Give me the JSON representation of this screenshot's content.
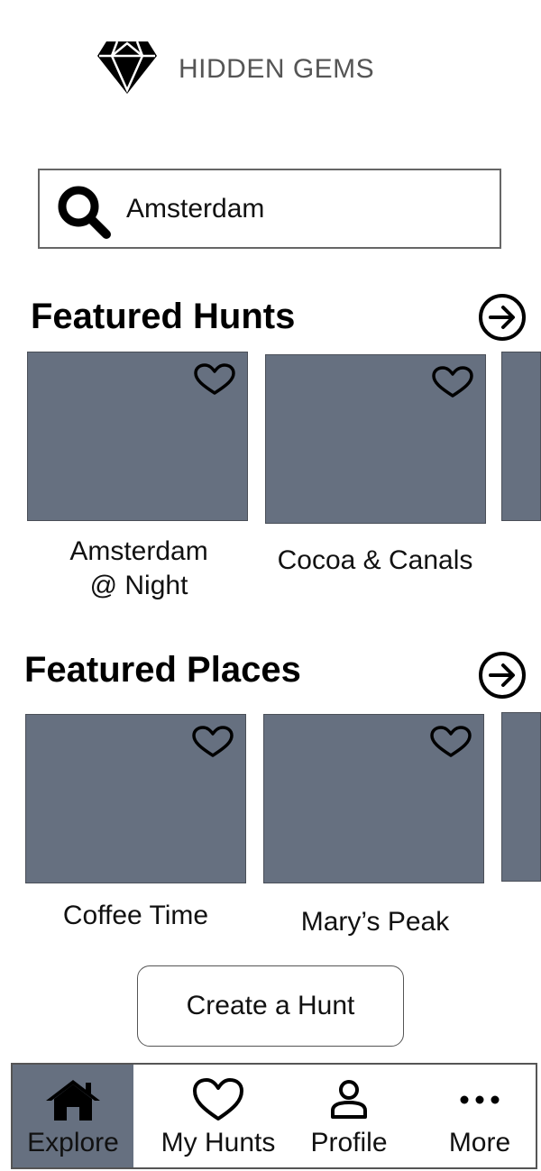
{
  "header": {
    "title": "HIDDEN GEMS",
    "logo_icon": "diamond-icon"
  },
  "search": {
    "value": "Amsterdam",
    "icon": "search-icon"
  },
  "featured_hunts": {
    "title": "Featured Hunts",
    "items": [
      {
        "label_line1": "Amsterdam",
        "label_line2": "@ Night"
      },
      {
        "label_line1": "Cocoa & Canals",
        "label_line2": ""
      }
    ]
  },
  "featured_places": {
    "title": "Featured Places",
    "items": [
      {
        "label_line1": "Coffee Time"
      },
      {
        "label_line1": "Mary’s Peak"
      }
    ]
  },
  "create_button": {
    "label": "Create a Hunt"
  },
  "nav": {
    "items": [
      {
        "label": "Explore",
        "icon": "home-icon",
        "active": true
      },
      {
        "label": "My Hunts",
        "icon": "heart-icon",
        "active": false
      },
      {
        "label": "Profile",
        "icon": "person-icon",
        "active": false
      },
      {
        "label": "More",
        "icon": "more-icon",
        "active": false
      }
    ]
  },
  "colors": {
    "card_fill": "#667080",
    "active_tab": "#667080",
    "title_gray": "#555555"
  }
}
